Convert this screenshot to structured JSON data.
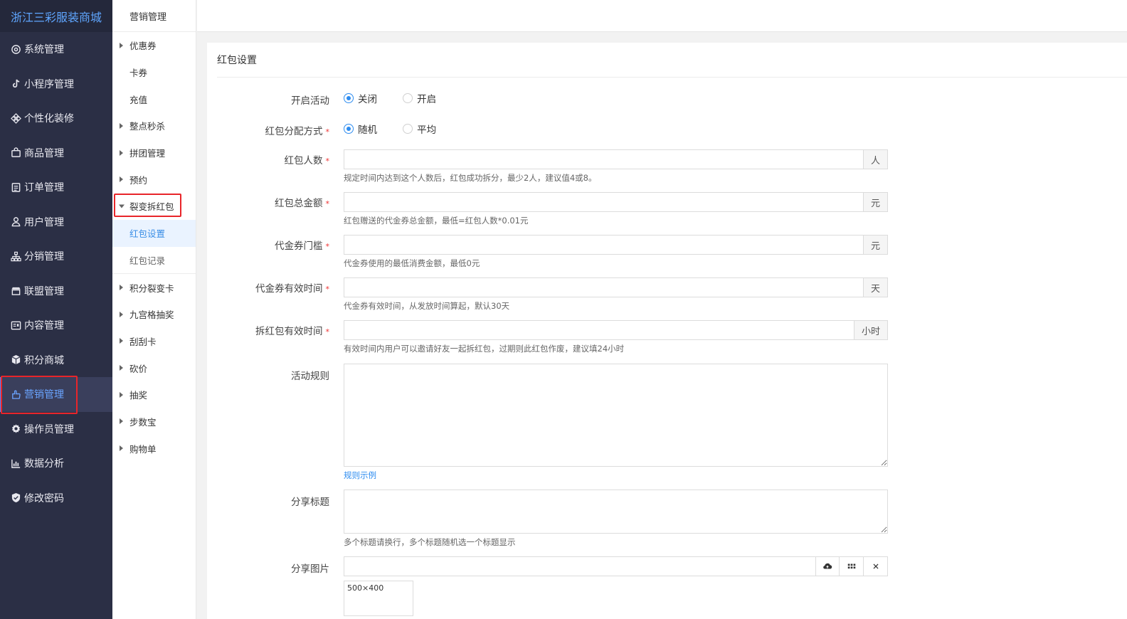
{
  "brand": "浙江三彩服装商城",
  "nav": [
    {
      "label": "系统管理",
      "icon": "settings-icon"
    },
    {
      "label": "小程序管理",
      "icon": "tiktok-icon"
    },
    {
      "label": "个性化装修",
      "icon": "decor-icon"
    },
    {
      "label": "商品管理",
      "icon": "bag-icon"
    },
    {
      "label": "订单管理",
      "icon": "order-icon"
    },
    {
      "label": "用户管理",
      "icon": "user-icon"
    },
    {
      "label": "分销管理",
      "icon": "sitemap-icon"
    },
    {
      "label": "联盟管理",
      "icon": "store-icon"
    },
    {
      "label": "内容管理",
      "icon": "content-icon"
    },
    {
      "label": "积分商城",
      "icon": "cube-icon"
    },
    {
      "label": "营销管理",
      "icon": "marketing-icon",
      "active": true
    },
    {
      "label": "操作员管理",
      "icon": "gear-icon"
    },
    {
      "label": "数据分析",
      "icon": "chart-icon"
    },
    {
      "label": "修改密码",
      "icon": "shield-icon"
    }
  ],
  "submenu": {
    "title": "营销管理",
    "items": [
      {
        "label": "优惠券",
        "arrow": "right"
      },
      {
        "label": "卡券",
        "arrow": "none"
      },
      {
        "label": "充值",
        "arrow": "none"
      },
      {
        "label": "整点秒杀",
        "arrow": "right"
      },
      {
        "label": "拼团管理",
        "arrow": "right"
      },
      {
        "label": "预约",
        "arrow": "right"
      },
      {
        "label": "裂变拆红包",
        "arrow": "down"
      },
      {
        "label": "红包设置",
        "child": true,
        "active": true
      },
      {
        "label": "红包记录",
        "child": true
      },
      {
        "label": "积分裂变卡",
        "arrow": "right"
      },
      {
        "label": "九宫格抽奖",
        "arrow": "right"
      },
      {
        "label": "刮刮卡",
        "arrow": "right"
      },
      {
        "label": "砍价",
        "arrow": "right"
      },
      {
        "label": "抽奖",
        "arrow": "right"
      },
      {
        "label": "步数宝",
        "arrow": "right"
      },
      {
        "label": "购物单",
        "arrow": "right"
      }
    ]
  },
  "panel": {
    "title": "红包设置",
    "activity": {
      "label": "开启活动",
      "options": [
        "关闭",
        "开启"
      ],
      "selected": "关闭"
    },
    "mode": {
      "label": "红包分配方式",
      "options": [
        "随机",
        "平均"
      ],
      "selected": "随机"
    },
    "fields": [
      {
        "label": "红包人数",
        "unit": "人",
        "value": "",
        "help": "规定时间内达到这个人数后，红包成功拆分，最少2人，建议值4或8。"
      },
      {
        "label": "红包总金额",
        "unit": "元",
        "value": "",
        "help": "红包赠送的代金券总金额，最低=红包人数*0.01元"
      },
      {
        "label": "代金券门槛",
        "unit": "元",
        "value": "",
        "help": "代金券使用的最低消费金额，最低0元"
      },
      {
        "label": "代金券有效时间",
        "unit": "天",
        "value": "",
        "help": "代金券有效时间，从发放时间算起，默认30天"
      },
      {
        "label": "拆红包有效时间",
        "unit": "小时",
        "value": "",
        "help": "有效时间内用户可以邀请好友一起拆红包，过期则此红包作废，建议填24小时"
      }
    ],
    "rules": {
      "label": "活动规则",
      "value": "",
      "link": "规则示例"
    },
    "share_title": {
      "label": "分享标题",
      "value": "",
      "help": "多个标题请换行，多个标题随机选一个标题显示"
    },
    "share_image": {
      "label": "分享图片",
      "value": "",
      "size": "500×400"
    }
  }
}
